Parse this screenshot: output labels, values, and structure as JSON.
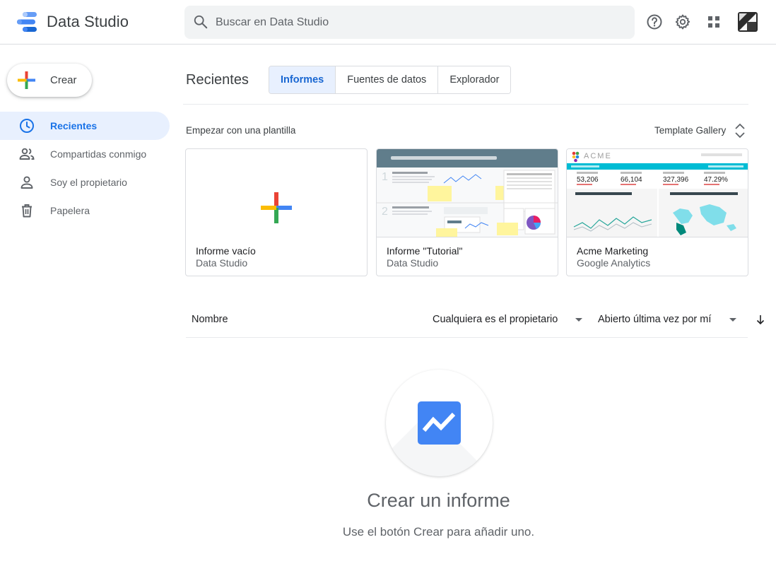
{
  "header": {
    "title": "Data Studio",
    "search_placeholder": "Buscar en Data Studio",
    "icons": [
      "logo-icon",
      "search-icon",
      "help-icon",
      "gear-icon",
      "apps-grid-icon",
      "account-avatar"
    ]
  },
  "sidebar": {
    "create_label": "Crear",
    "items": [
      {
        "label": "Recientes",
        "icon": "clock-icon",
        "active": true
      },
      {
        "label": "Compartidas conmigo",
        "icon": "people-icon",
        "active": false
      },
      {
        "label": "Soy el propietario",
        "icon": "person-icon",
        "active": false
      },
      {
        "label": "Papelera",
        "icon": "trash-icon",
        "active": false
      }
    ]
  },
  "main": {
    "section_title": "Recientes",
    "tabs": [
      {
        "label": "Informes",
        "active": true
      },
      {
        "label": "Fuentes de datos",
        "active": false
      },
      {
        "label": "Explorador",
        "active": false
      }
    ],
    "templates_heading": "Empezar con una plantilla",
    "template_gallery_label": "Template Gallery",
    "templates": [
      {
        "title": "Informe vacío",
        "subtitle": "Data Studio"
      },
      {
        "title": "Informe \"Tutorial\"",
        "subtitle": "Data Studio"
      },
      {
        "title": "Acme Marketing",
        "subtitle": "Google Analytics"
      }
    ],
    "list": {
      "name_col": "Nombre",
      "owner_filter": "Cualquiera es el propietario",
      "sort_filter": "Abierto última vez por mí"
    },
    "empty": {
      "title": "Crear un informe",
      "subtitle": "Use el botón Crear para añadir uno."
    }
  },
  "colors": {
    "accent_blue": "#1a73e8",
    "active_bg": "#e8f0fe",
    "google_blue": "#4285f4",
    "google_red": "#ea4335",
    "google_yellow": "#fbbc04",
    "google_green": "#34a853"
  }
}
